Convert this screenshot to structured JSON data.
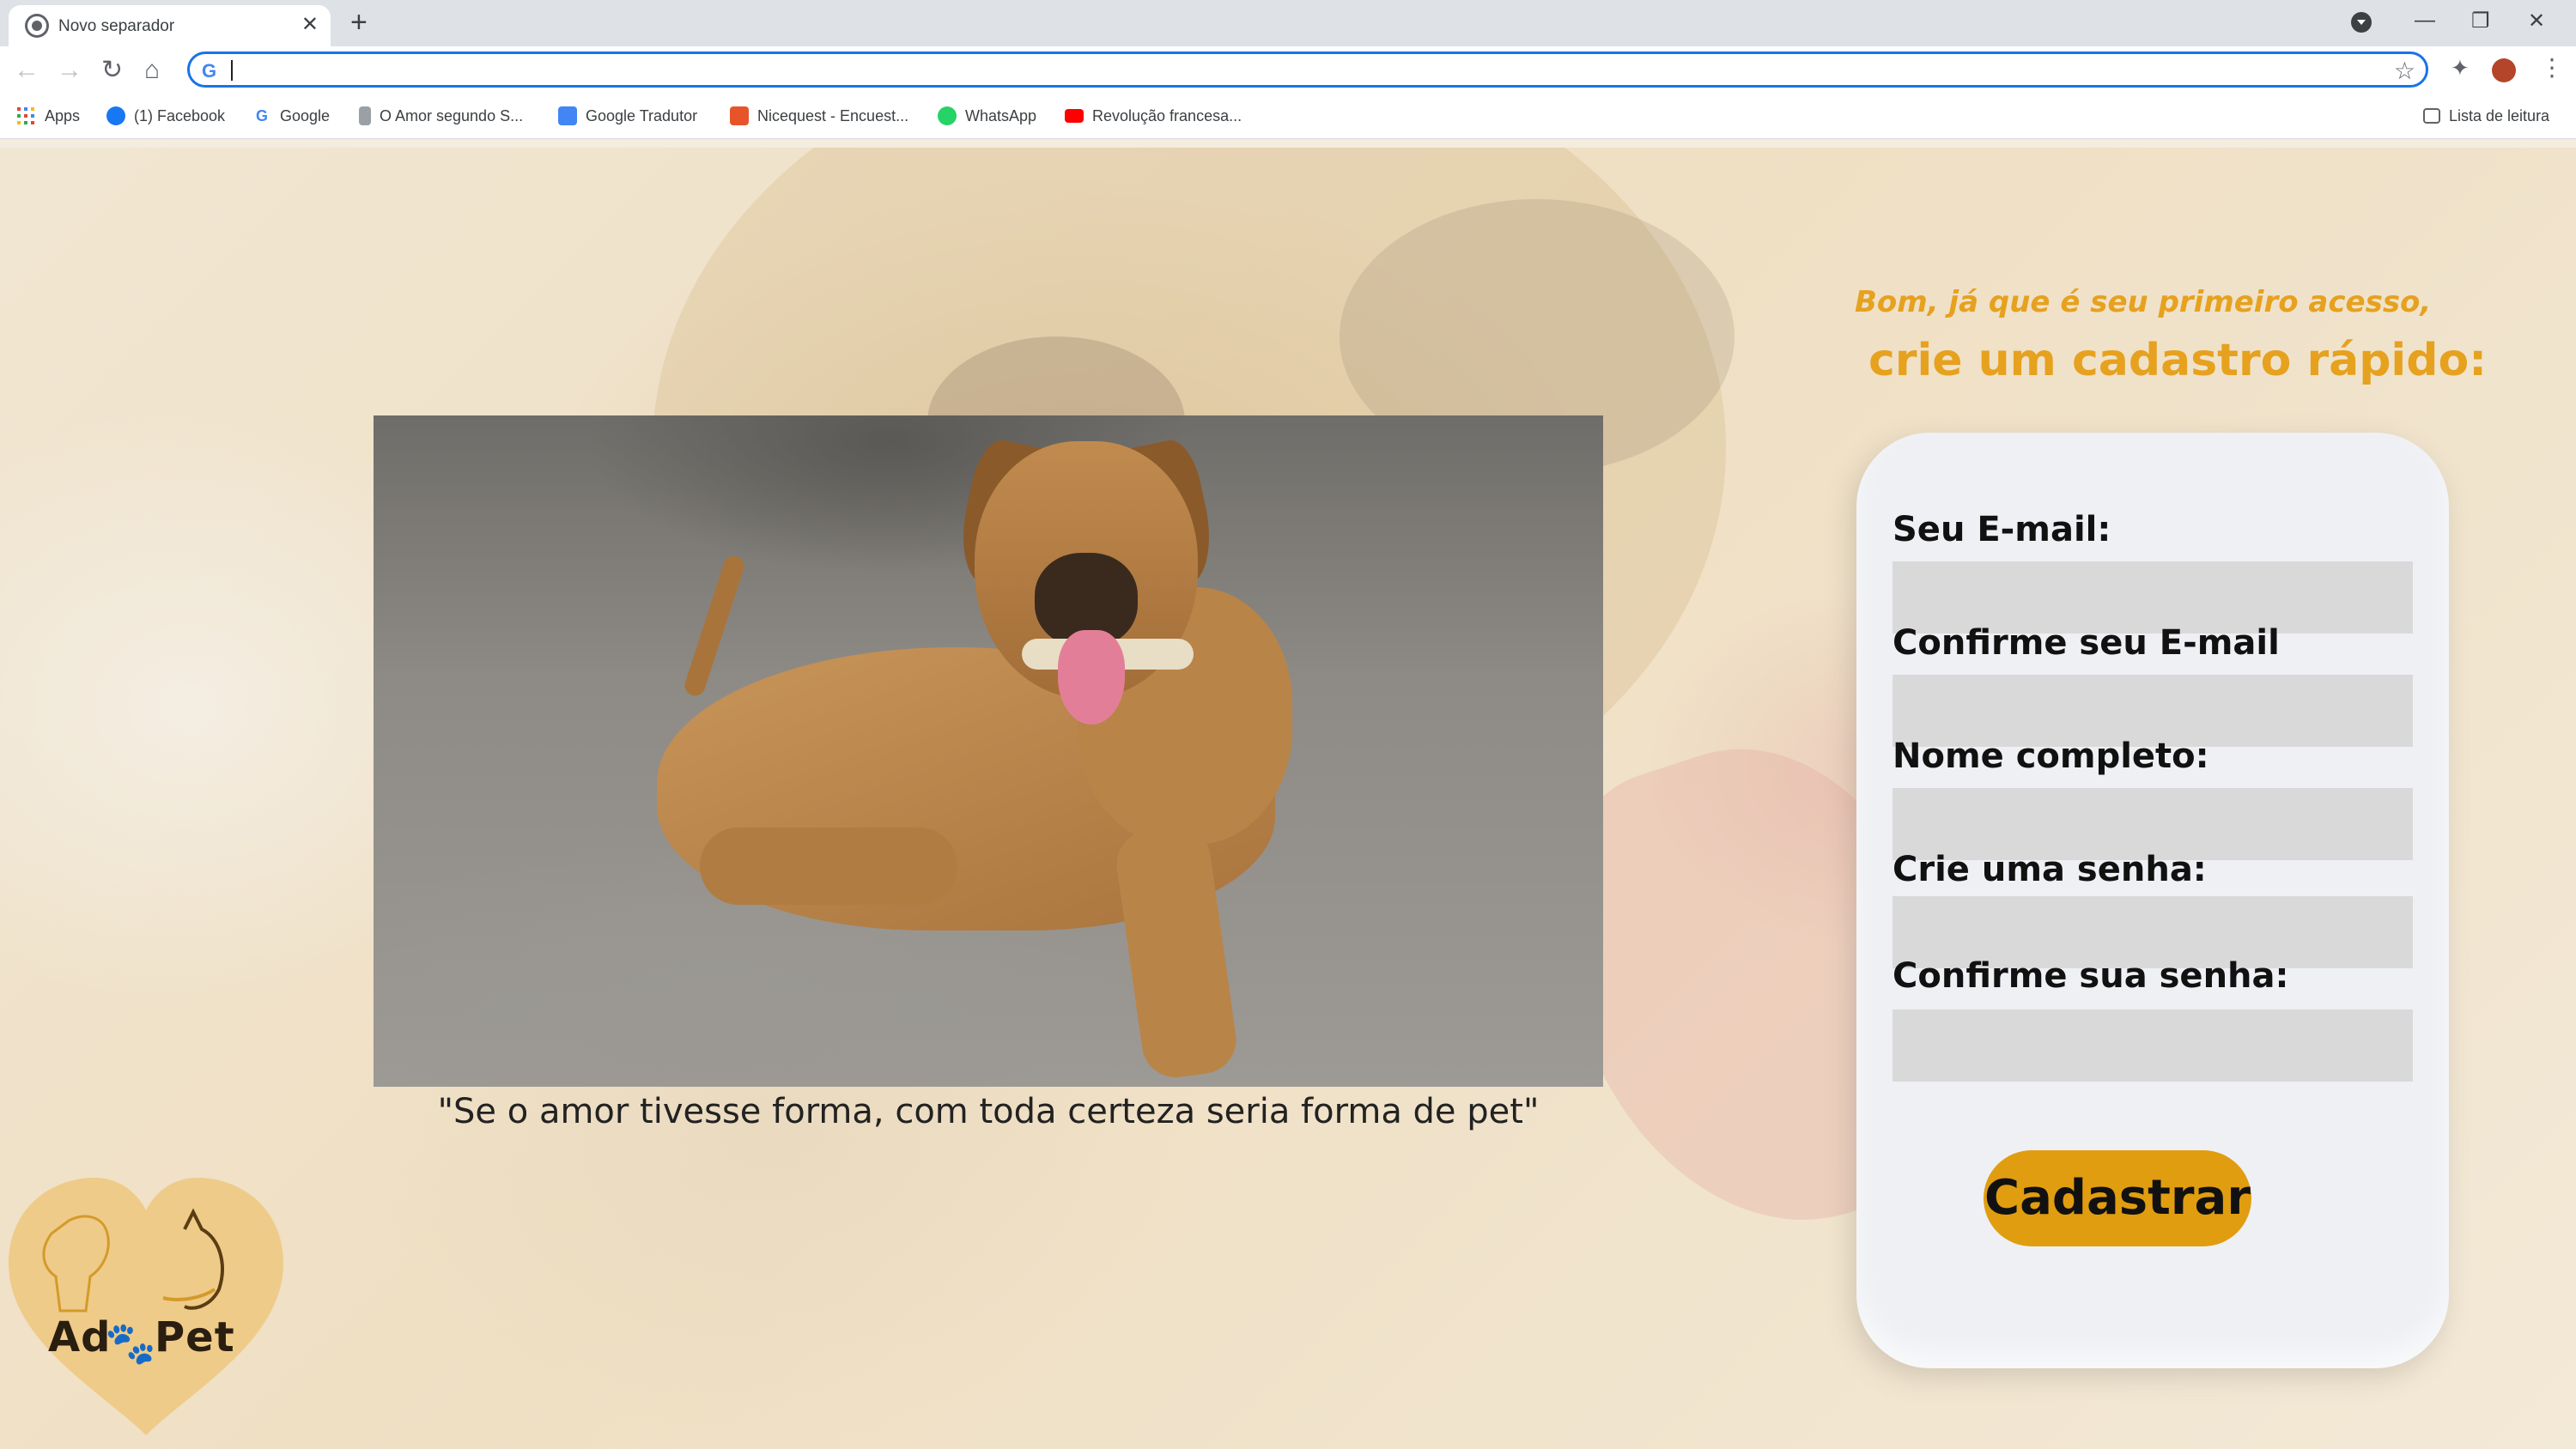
{
  "browser": {
    "tab_title": "Novo separador",
    "url": "",
    "bookmarks": [
      {
        "label": "Apps"
      },
      {
        "label": "(1) Facebook"
      },
      {
        "label": "Google"
      },
      {
        "label": "O Amor segundo S..."
      },
      {
        "label": "Google Tradutor"
      },
      {
        "label": "Nicequest - Encuest..."
      },
      {
        "label": "WhatsApp"
      },
      {
        "label": "Revolução francesa..."
      }
    ],
    "reading_list": "Lista de leitura"
  },
  "hero": {
    "quote": "\"Se o amor tivesse forma, com toda certeza seria  forma de pet\""
  },
  "logo": {
    "text_before": "Ad",
    "text_after": "Pet"
  },
  "intro": {
    "line1": "Bom, já que é seu primeiro acesso,",
    "line2": "crie um cadastro rápido:"
  },
  "form": {
    "email_label": "Seu E-mail:",
    "confirm_email_label": "Confirme seu E-mail",
    "name_label": "Nome completo:",
    "password_label": "Crie uma senha:",
    "confirm_password_label": "Confirme sua senha:",
    "submit_label": "Cadastrar"
  },
  "colors": {
    "accent": "#e6a11e",
    "button": "#e19d10",
    "input_bg": "#d9d9d9",
    "card_bg": "#eef0f4"
  },
  "icons": [
    "chrome-favicon",
    "close-icon",
    "plus-icon",
    "back-icon",
    "forward-icon",
    "reload-icon",
    "home-icon",
    "google-icon",
    "star-icon",
    "extensions-icon",
    "profile-avatar",
    "menu-icon",
    "apps-icon",
    "facebook-icon",
    "whatsapp-icon",
    "youtube-icon",
    "reading-list-icon"
  ]
}
